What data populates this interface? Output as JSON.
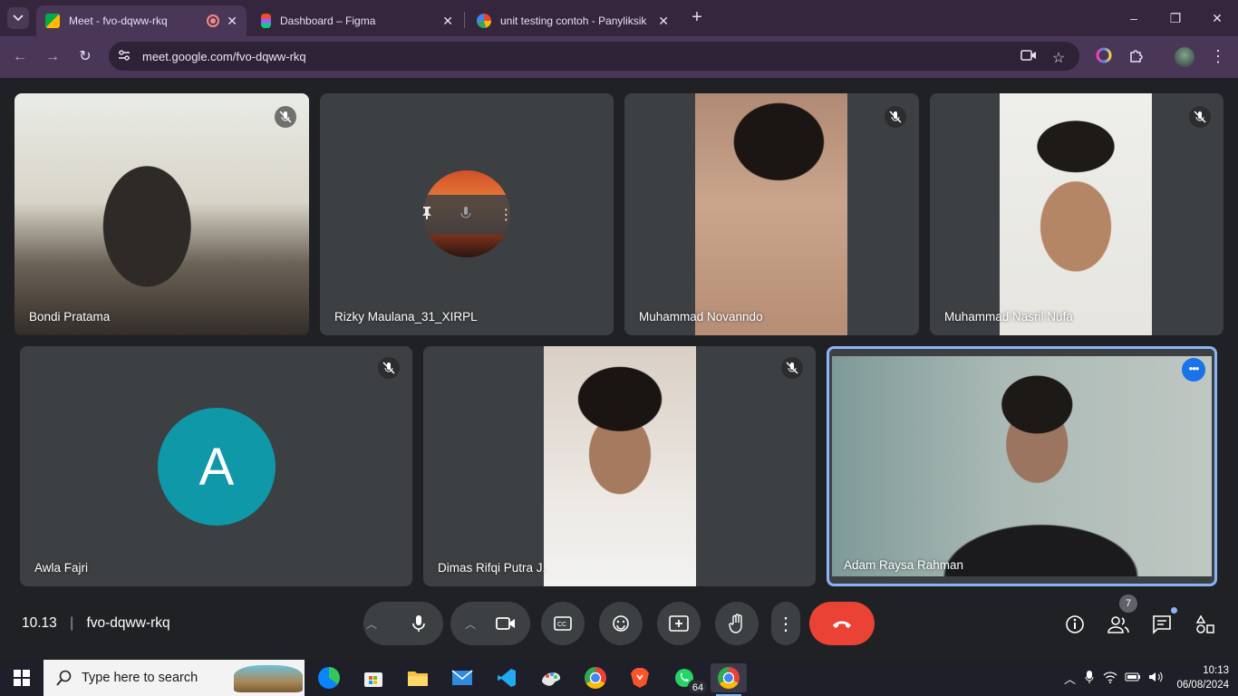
{
  "browser": {
    "tabs": [
      {
        "title": "Meet - fvo-dqww-rkq",
        "recording": true
      },
      {
        "title": "Dashboard – Figma"
      },
      {
        "title": "unit testing contoh - Panyliksik"
      }
    ],
    "url": "meet.google.com/fvo-dqww-rkq",
    "new_tab_label": "+",
    "window_controls": {
      "minimize": "–",
      "restore": "❐",
      "close": "✕"
    }
  },
  "meet": {
    "participants": [
      {
        "name": "Bondi Pratama",
        "muted": true
      },
      {
        "name": "Rizky Maulana_31_XIRPL",
        "muted": false
      },
      {
        "name": "Muhammad Novanndo",
        "muted": true
      },
      {
        "name": "Muhammad Nasril Nufa",
        "muted": true
      },
      {
        "name": "Awla Fajri",
        "muted": true,
        "avatar_letter": "A"
      },
      {
        "name": "Dimas Rifqi Putra J.",
        "muted": true
      },
      {
        "name": "Adam Raysa Rahman",
        "muted": false,
        "self": true
      }
    ],
    "time": "10.13",
    "separator": "|",
    "meeting_code": "fvo-dqww-rkq",
    "people_count": "7"
  },
  "taskbar": {
    "search_placeholder": "Type here to search",
    "whatsapp_badge": "64",
    "clock_time": "10:13",
    "clock_date": "06/08/2024"
  },
  "colors": {
    "end_call": "#ea4335",
    "avatar_bg": "#0e98a8",
    "active_speaker_border": "#8ab4f8",
    "tab_strip": "#35263e"
  }
}
